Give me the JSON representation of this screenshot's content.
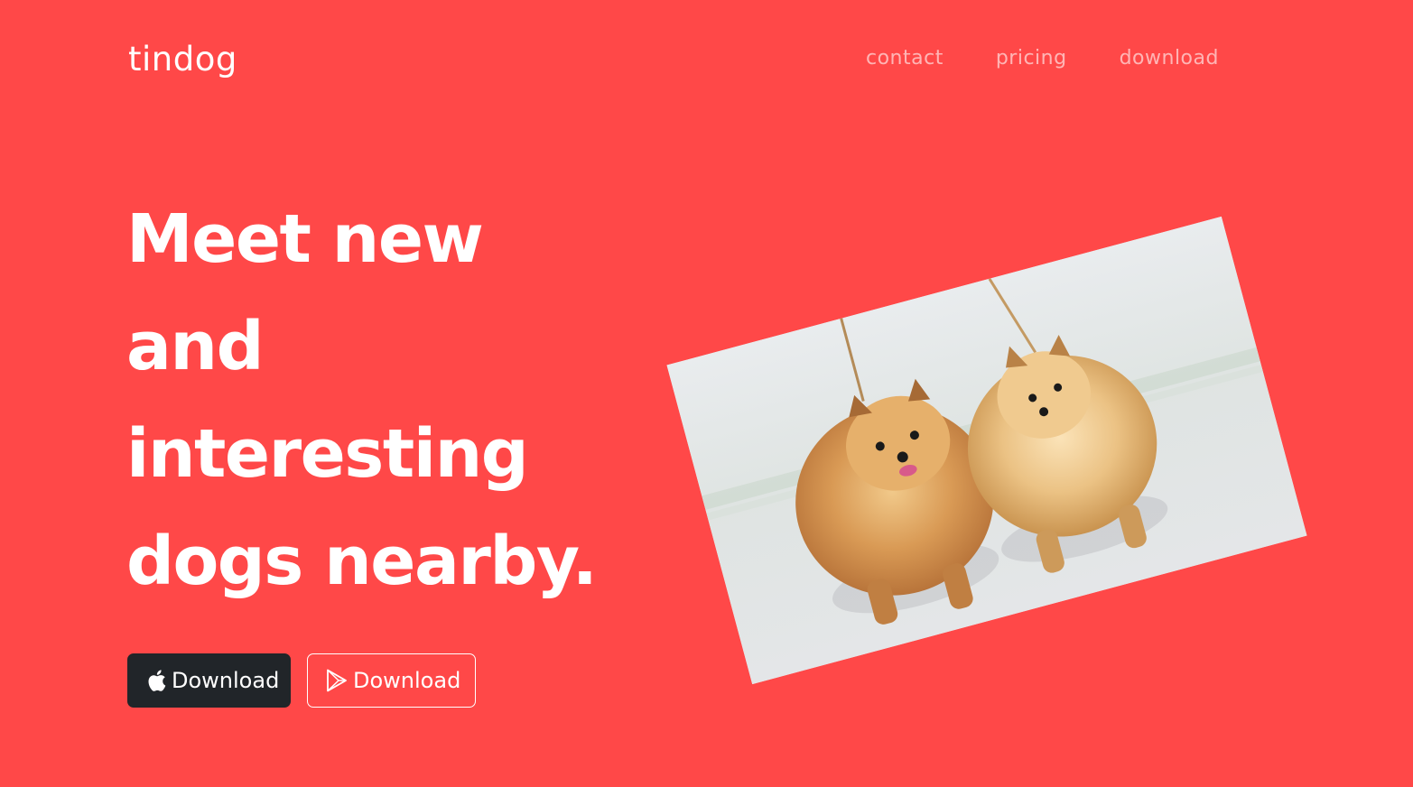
{
  "brand": {
    "name": "tindog"
  },
  "nav": {
    "items": [
      {
        "label": "contact"
      },
      {
        "label": "pricing"
      },
      {
        "label": "download"
      }
    ]
  },
  "hero": {
    "headline_lines": [
      "Meet new",
      "and",
      "interesting",
      "dogs nearby."
    ],
    "buttons": {
      "apple": {
        "label": "Download",
        "icon": "apple-icon"
      },
      "play": {
        "label": "Download",
        "icon": "google-play-icon"
      }
    },
    "image": {
      "subject": "two Pomeranian dogs on leashes",
      "rotation": "tilted counter-clockwise"
    }
  },
  "colors": {
    "background": "#ff4848",
    "dark_button": "#212529",
    "text": "#ffffff",
    "nav_text": "rgba(255,255,255,0.6)"
  }
}
